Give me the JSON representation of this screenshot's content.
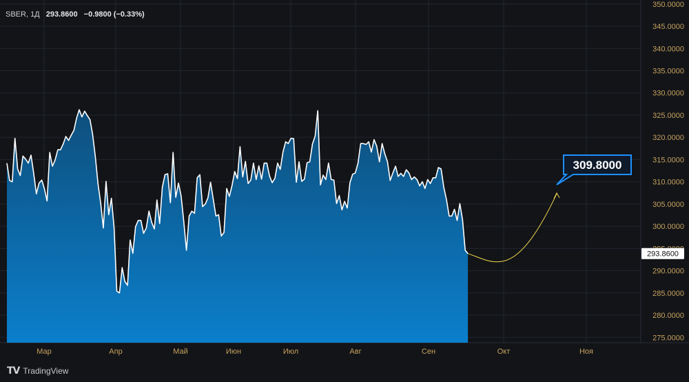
{
  "legend": {
    "symbol": "SBER, 1Д",
    "last": "293.8600",
    "change": "−0.9800 (−0.33%)"
  },
  "price_label": "293.8600",
  "target_label": "309.8000",
  "brand": {
    "logo": "TV",
    "name": "TradingView"
  },
  "colors": {
    "background": "#121418",
    "grid": "#23262d",
    "area_top": "#0e4f7c",
    "area_bottom": "#0b7fcc",
    "line": "#ffffff",
    "axis_text": "#c7a25d",
    "callout_border": "#1e90ff",
    "callout_fill": "#0f1a2a",
    "projection": "#f2d84a"
  },
  "chart_data": {
    "type": "area",
    "series": [
      {
        "values": [
          314.2,
          310.3,
          310.0,
          319.8,
          312.9,
          311.4,
          315.8,
          315.1,
          314.2,
          316.0,
          311.9,
          307.3,
          309.7,
          310.4,
          308.4,
          305.7,
          316.6,
          313.5,
          314.9,
          317.2,
          317.2,
          318.5,
          320.2,
          319.3,
          320.5,
          321.6,
          324.3,
          326.2,
          324.6,
          325.9,
          324.9,
          324.0,
          320.6,
          315.6,
          309.5,
          305.1,
          299.6,
          310.1,
          302.6,
          306.3,
          299.7,
          285.4,
          285.0,
          290.7,
          287.6,
          286.7,
          296.9,
          293.9,
          299.9,
          301.3,
          301.3,
          298.4,
          299.6,
          303.4,
          300.9,
          299.4,
          305.9,
          300.6,
          308.8,
          311.6,
          311.8,
          305.3,
          316.6,
          306.5,
          309.7,
          306.8,
          301.1,
          294.6,
          302.3,
          303.4,
          302.9,
          310.9,
          311.6,
          304.4,
          305.0,
          306.4,
          309.9,
          306.1,
          302.3,
          302.6,
          297.8,
          298.6,
          308.5,
          306.7,
          309.2,
          312.3,
          310.7,
          317.9,
          311.1,
          314.6,
          309.6,
          310.4,
          314.2,
          310.5,
          313.6,
          310.6,
          314.2,
          314.2,
          311.3,
          309.8,
          310.8,
          314.2,
          312.8,
          316.7,
          319.0,
          318.6,
          319.8,
          319.7,
          309.9,
          314.5,
          310.1,
          310.6,
          314.3,
          314.5,
          318.5,
          320.3,
          326.0,
          309.3,
          311.5,
          310.5,
          314.2,
          310.5,
          310.4,
          305.1,
          306.9,
          303.7,
          305.6,
          304.1,
          309.8,
          311.7,
          312.0,
          314.2,
          318.6,
          318.6,
          318.4,
          319.0,
          316.7,
          319.5,
          318.0,
          314.5,
          318.6,
          316.3,
          314.5,
          310.3,
          312.0,
          313.5,
          311.2,
          311.9,
          311.2,
          312.7,
          312.0,
          310.5,
          311.1,
          310.5,
          309.1,
          310.0,
          308.5,
          310.5,
          309.6,
          310.9,
          310.9,
          313.2,
          312.9,
          308.8,
          306.0,
          302.3,
          302.3,
          303.8,
          301.3,
          305.1,
          301.5,
          294.6,
          293.86
        ]
      }
    ],
    "x_labels": [
      "Мар",
      "Апр",
      "Май",
      "Июн",
      "Июл",
      "Авг",
      "Сен",
      "Окт",
      "Ноя"
    ],
    "y_ticks": [
      "275.0000",
      "280.0000",
      "285.0000",
      "290.0000",
      "295.0000",
      "300.0000",
      "305.0000",
      "310.0000",
      "315.0000",
      "320.0000",
      "325.0000",
      "330.0000",
      "335.0000",
      "340.0000",
      "345.0000",
      "350.0000"
    ],
    "ylim": [
      273.8,
      350.9
    ],
    "last_value": 293.86,
    "target_value": 309.8,
    "grid": true
  }
}
